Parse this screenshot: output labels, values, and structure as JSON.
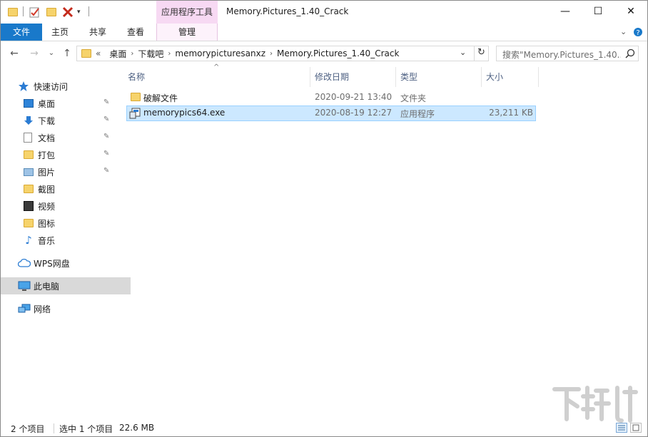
{
  "window": {
    "title": "Memory.Pictures_1.40_Crack",
    "context_tab": "应用程序工具",
    "controls": {
      "minimize": "—",
      "maximize": "☐",
      "close": "✕"
    }
  },
  "ribbon": {
    "tabs": [
      {
        "label": "文件"
      },
      {
        "label": "主页"
      },
      {
        "label": "共享"
      },
      {
        "label": "查看"
      },
      {
        "label": "管理"
      }
    ],
    "expand_icon": "chevron-down-icon",
    "help_icon": "help-icon"
  },
  "address": {
    "overflow": "«",
    "breadcrumbs": [
      "桌面",
      "下载吧",
      "memorypicturesanxz",
      "Memory.Pictures_1.40_Crack"
    ]
  },
  "search": {
    "placeholder": "搜索\"Memory.Pictures_1.40..."
  },
  "sidebar": {
    "quick_access": "快速访问",
    "items": [
      {
        "label": "桌面",
        "pinned": true,
        "icon": "desktop-icon"
      },
      {
        "label": "下载",
        "pinned": true,
        "icon": "download-icon"
      },
      {
        "label": "文档",
        "pinned": true,
        "icon": "document-icon"
      },
      {
        "label": "打包",
        "pinned": true,
        "icon": "folder-icon"
      },
      {
        "label": "图片",
        "pinned": true,
        "icon": "pictures-icon"
      },
      {
        "label": "截图",
        "pinned": false,
        "icon": "folder-icon"
      },
      {
        "label": "视频",
        "pinned": false,
        "icon": "video-icon"
      },
      {
        "label": "图标",
        "pinned": false,
        "icon": "folder-icon"
      },
      {
        "label": "音乐",
        "pinned": false,
        "icon": "music-icon"
      }
    ],
    "wps": "WPS网盘",
    "this_pc": "此电脑",
    "network": "网络"
  },
  "list": {
    "columns": {
      "name": "名称",
      "date": "修改日期",
      "type": "类型",
      "size": "大小"
    },
    "rows": [
      {
        "name": "破解文件",
        "date": "2020-09-21 13:40",
        "type": "文件夹",
        "size": "",
        "icon": "folder-icon",
        "selected": false
      },
      {
        "name": "memorypics64.exe",
        "date": "2020-08-19 12:27",
        "type": "应用程序",
        "size": "23,211 KB",
        "icon": "exe-icon",
        "selected": true
      }
    ]
  },
  "status": {
    "count": "2 个项目",
    "selected": "选中 1 个项目",
    "size": "22.6 MB"
  },
  "colors": {
    "file_tab": "#1979ca",
    "context_tab": "#f7d9f3",
    "selection": "#cce8ff",
    "selection_border": "#99d1ff",
    "header_text": "#4d6082"
  }
}
